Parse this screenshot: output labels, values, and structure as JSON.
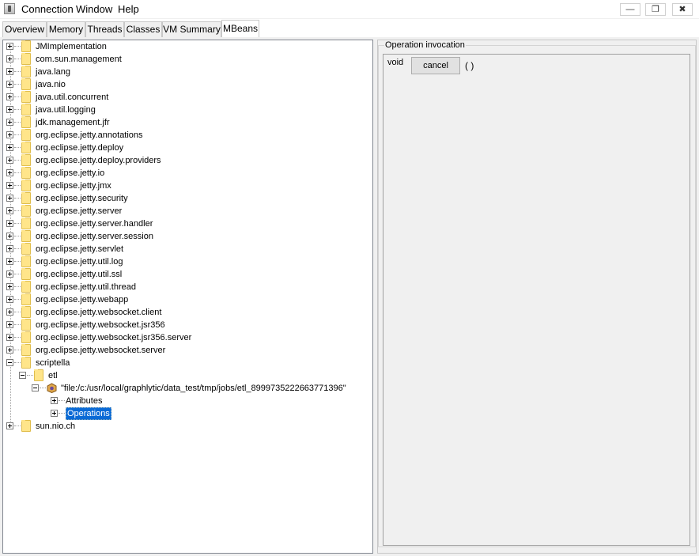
{
  "menubar": {
    "items": [
      "Connection",
      "Window",
      "Help"
    ]
  },
  "window_controls": {
    "minimize": "—",
    "restore": "❐",
    "close": "✖"
  },
  "tabs": [
    "Overview",
    "Memory",
    "Threads",
    "Classes",
    "VM Summary",
    "MBeans"
  ],
  "active_tab": "MBeans",
  "tree": {
    "domains": [
      "JMImplementation",
      "com.sun.management",
      "java.lang",
      "java.nio",
      "java.util.concurrent",
      "java.util.logging",
      "jdk.management.jfr",
      "org.eclipse.jetty.annotations",
      "org.eclipse.jetty.deploy",
      "org.eclipse.jetty.deploy.providers",
      "org.eclipse.jetty.io",
      "org.eclipse.jetty.jmx",
      "org.eclipse.jetty.security",
      "org.eclipse.jetty.server",
      "org.eclipse.jetty.server.handler",
      "org.eclipse.jetty.server.session",
      "org.eclipse.jetty.servlet",
      "org.eclipse.jetty.util.log",
      "org.eclipse.jetty.util.ssl",
      "org.eclipse.jetty.util.thread",
      "org.eclipse.jetty.webapp",
      "org.eclipse.jetty.websocket.client",
      "org.eclipse.jetty.websocket.jsr356",
      "org.eclipse.jetty.websocket.jsr356.server",
      "org.eclipse.jetty.websocket.server"
    ],
    "expanded": {
      "domain": "scriptella",
      "type": "etl",
      "bean": "\"file:/c:/usr/local/graphlytic/data_test/tmp/jobs/etl_8999735222663771396\"",
      "children": [
        "Attributes",
        "Operations"
      ],
      "selected": "Operations"
    },
    "last": "sun.nio.ch"
  },
  "operation_panel": {
    "title": "Operation invocation",
    "return_type": "void",
    "button_label": "cancel",
    "params": "( )"
  }
}
